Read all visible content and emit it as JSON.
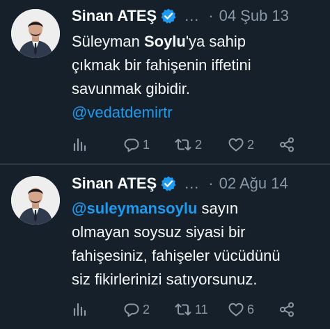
{
  "theme": {
    "background": "#15202b",
    "text": "#f7f9f9",
    "muted": "#8b98a5",
    "accent": "#1d9bf0",
    "divider": "#2c3a47"
  },
  "tweets": [
    {
      "author": {
        "name": "Sinan ATEŞ",
        "verified": true,
        "handle_truncated": "…",
        "avatar_icon": "profile-photo"
      },
      "separator": "·",
      "date": "04 Şub 13",
      "body": {
        "line1_prefix": "Süleyman ",
        "line1_bold": "Soylu",
        "line1_suffix": "'ya sahip",
        "line2": "çıkmak bir fahişenin iffetini",
        "line3": "savunmak gibidir.",
        "line4_mention": "@vedatdemirtr"
      },
      "actions": {
        "analytics_icon": "analytics-icon",
        "replies": "1",
        "retweets": "2",
        "likes": "2",
        "share_icon": "share-icon"
      }
    },
    {
      "author": {
        "name": "Sinan ATEŞ",
        "verified": true,
        "handle_truncated": "…",
        "avatar_icon": "profile-photo"
      },
      "separator": "·",
      "date": "02 Ağu 14",
      "body": {
        "line1_mention": "@suleymansoylu",
        "line1_suffix": " sayın",
        "line2": "olmayan soysuz siyasi bir",
        "line3": "fahişesiniz, fahişeler vücüdünü",
        "line4": "siz fikirlerinizi satıyorsunuz."
      },
      "actions": {
        "analytics_icon": "analytics-icon",
        "replies": "2",
        "retweets": "11",
        "likes": "6",
        "share_icon": "share-icon"
      }
    }
  ]
}
